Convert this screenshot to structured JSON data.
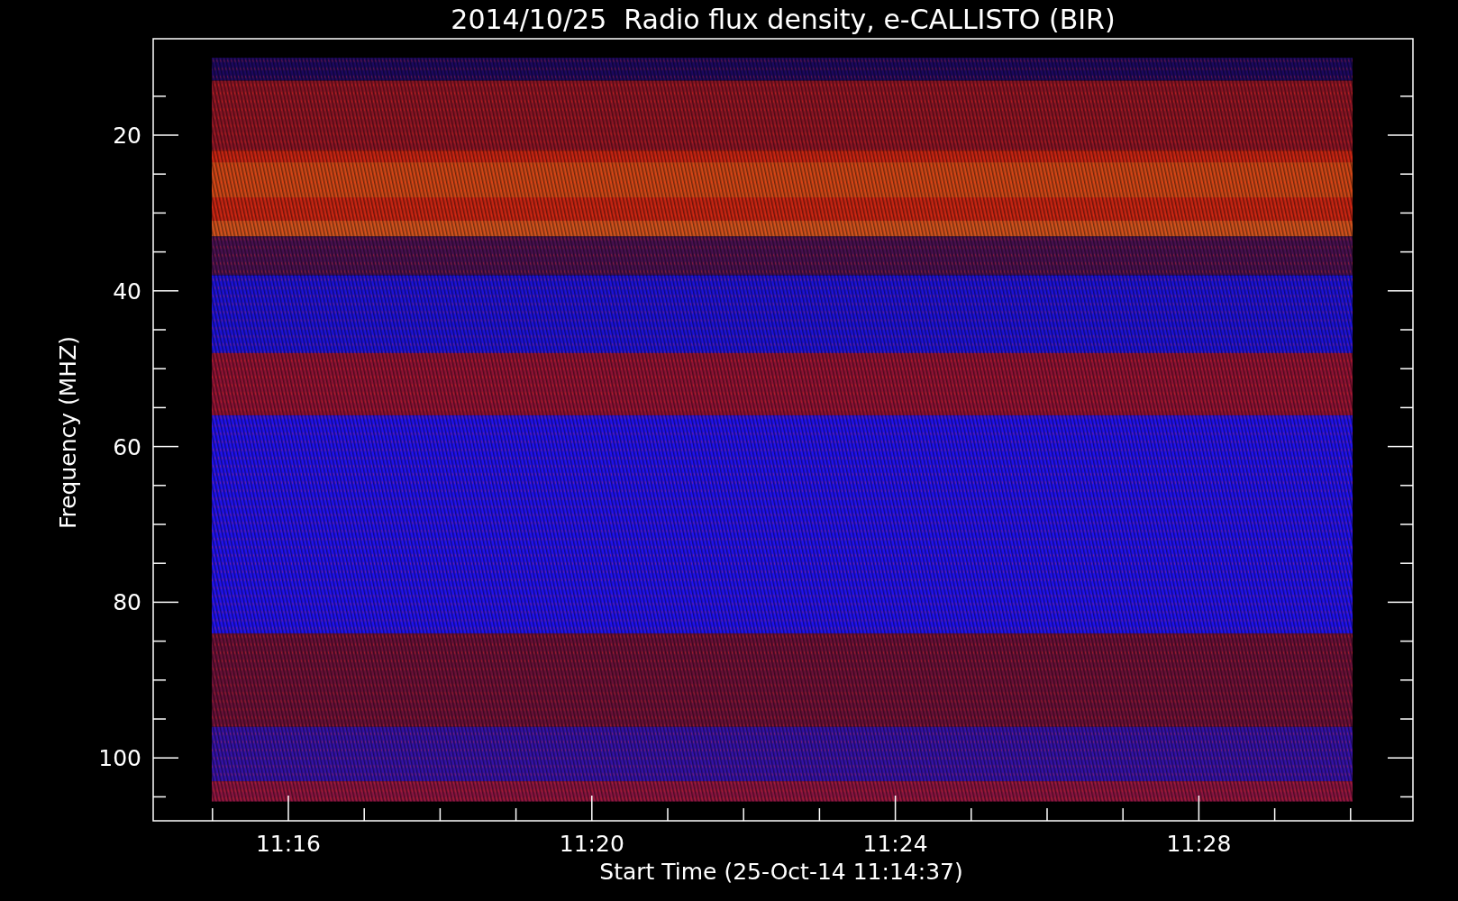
{
  "title": "2014/10/25  Radio flux density, e-CALLISTO (BIR)",
  "ylabel": "Frequency (MHZ)",
  "xlabel": "Start Time (25-Oct-14 11:14:37)",
  "y_tick_labels": [
    "20",
    "40",
    "60",
    "80",
    "100"
  ],
  "x_tick_labels": [
    "11:16",
    "11:20",
    "11:24",
    "11:28"
  ]
}
